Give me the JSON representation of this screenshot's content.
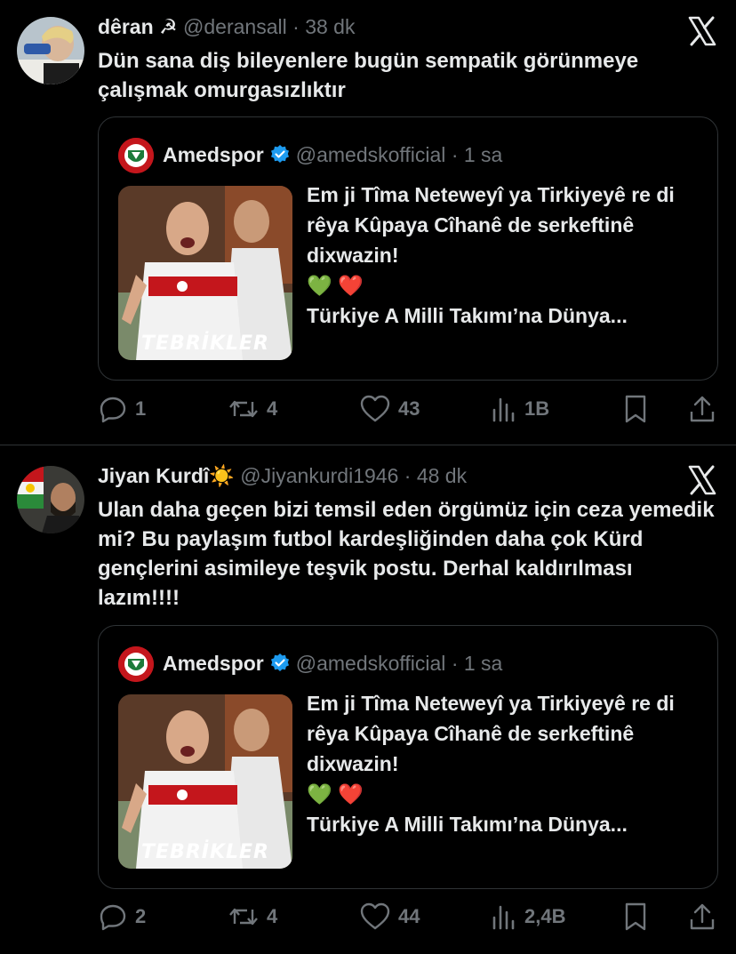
{
  "tweets": [
    {
      "author_name": "dêran",
      "author_emoji": "☭",
      "handle": "@deransall",
      "separator": "·",
      "time": "38 dk",
      "text": "Dün sana diş bileyenlere bugün sempatik görünmeye çalışmak omurgasızlıktır",
      "quote": {
        "author_name": "Amedspor",
        "handle": "@amedskofficial",
        "separator": "·",
        "time": "1 sa",
        "text": "Em ji Tîma Neteweyî ya Tirkiyeyê re di rêya Kûpaya Cîhanê de serkeftinê dixwazin!",
        "hearts": "💚 ❤️",
        "text_second": "Türkiye A Milli Takımı’na Dünya...",
        "image_caption": "TEBRİKLER"
      },
      "stats": {
        "replies": "1",
        "reposts": "4",
        "likes": "43",
        "views": "1B"
      }
    },
    {
      "author_name": "Jiyan Kurdî",
      "author_emoji": "☀️",
      "handle": "@Jiyankurdi1946",
      "separator": "·",
      "time": "48 dk",
      "text": "Ulan daha geçen bizi temsil eden örgümüz için ceza yemedik mi? Bu paylaşım futbol kardeşliğinden daha çok Kürd gençlerini asimileye teşvik postu. Derhal kaldırılması lazım!!!!",
      "quote": {
        "author_name": "Amedspor",
        "handle": "@amedskofficial",
        "separator": "·",
        "time": "1 sa",
        "text": "Em ji Tîma Neteweyî ya Tirkiyeyê re di rêya Kûpaya Cîhanê de serkeftinê dixwazin!",
        "hearts": "💚 ❤️",
        "text_second": "Türkiye A Milli Takımı’na Dünya...",
        "image_caption": "TEBRİKLER"
      },
      "stats": {
        "replies": "2",
        "reposts": "4",
        "likes": "44",
        "views": "2,4B"
      }
    }
  ],
  "icons": {
    "x_logo": "x-logo-icon",
    "reply": "reply-icon",
    "repost": "repost-icon",
    "like": "heart-icon",
    "views": "views-icon",
    "bookmark": "bookmark-icon",
    "share": "share-icon",
    "verified": "verified-badge-icon"
  },
  "colors": {
    "background": "#000000",
    "text": "#e7e9ea",
    "secondary": "#71767b",
    "border": "#2f3336",
    "verified": "#1d9bf0",
    "amedspor_red": "#c4161c",
    "amedspor_green": "#1c7a3a"
  }
}
